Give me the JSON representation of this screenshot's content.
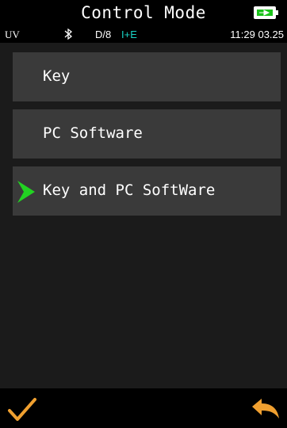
{
  "header": {
    "title": "Control Mode",
    "battery_icon": "battery-charging-icon"
  },
  "status": {
    "uv": "UV",
    "bluetooth_icon": "bluetooth-icon",
    "geometry": "D/8",
    "mode": "I+E",
    "time": "11:29 03.25"
  },
  "menu": {
    "items": [
      {
        "label": "Key"
      },
      {
        "label": "PC Software"
      },
      {
        "label": "Key and PC SoftWare",
        "selected": true
      }
    ]
  },
  "footer": {
    "confirm_icon": "checkmark-icon",
    "back_icon": "return-arrow-icon"
  },
  "colors": {
    "accent_green": "#22d322",
    "confirm_orange": "#f0a030",
    "mode_cyan": "#19d6c8"
  }
}
